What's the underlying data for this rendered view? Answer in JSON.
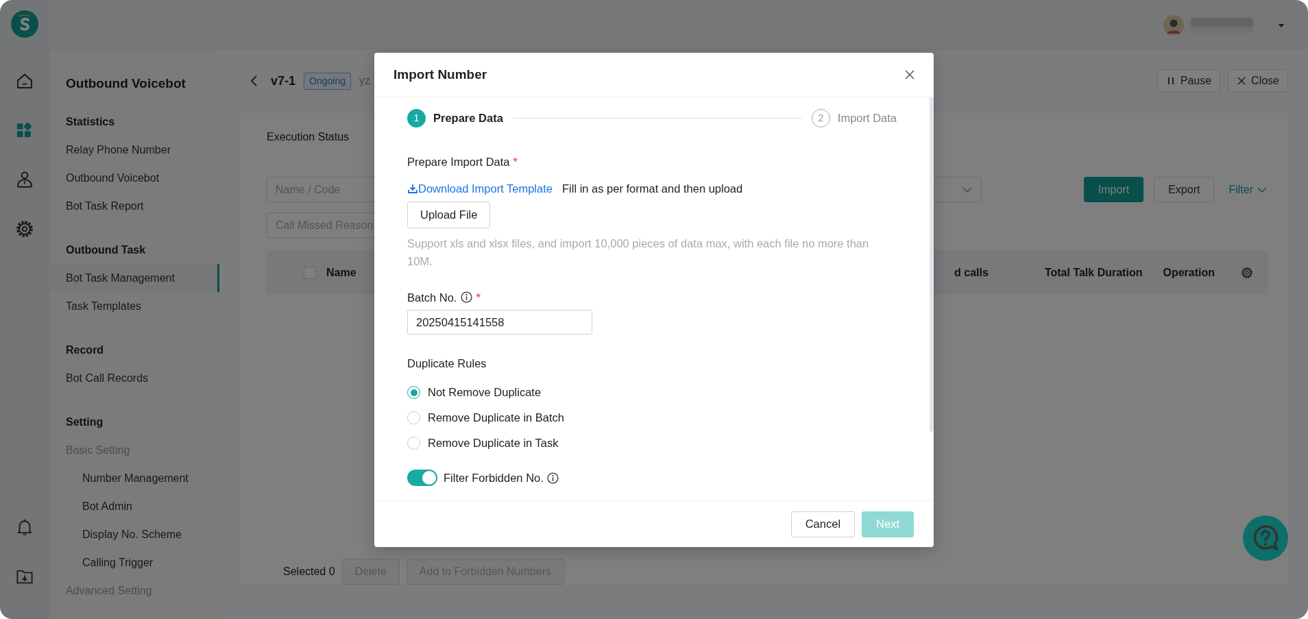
{
  "rail": {
    "top": [
      {
        "kind": "home",
        "selected": false
      },
      {
        "kind": "apps",
        "selected": true
      },
      {
        "kind": "user",
        "selected": false
      },
      {
        "kind": "settings",
        "selected": false
      }
    ],
    "bottom": [
      {
        "kind": "bell",
        "selected": false
      },
      {
        "kind": "download",
        "selected": false
      }
    ]
  },
  "sidebar": {
    "title": "Outbound Voicebot",
    "sections": [
      {
        "heading": "Statistics",
        "items": [
          {
            "label": "Relay Phone Number",
            "selected": false
          },
          {
            "label": "Outbound Voicebot",
            "selected": false
          },
          {
            "label": "Bot Task Report",
            "selected": false
          }
        ]
      },
      {
        "heading": "Outbound Task",
        "items": [
          {
            "label": "Bot Task Management",
            "selected": true
          },
          {
            "label": "Task Templates",
            "selected": false
          }
        ]
      },
      {
        "heading": "Record",
        "items": [
          {
            "label": "Bot Call Records",
            "selected": false
          }
        ]
      },
      {
        "heading": "Setting",
        "items": [
          {
            "kind": "group",
            "label": "Basic Setting",
            "selected": false,
            "children": [
              {
                "label": "Number Management",
                "selected": false
              },
              {
                "label": "Bot Admin",
                "selected": false
              },
              {
                "label": "Display No. Scheme",
                "selected": false
              },
              {
                "label": "Calling Trigger",
                "selected": false
              }
            ]
          },
          {
            "kind": "group",
            "label": "Advanced Setting",
            "selected": false
          }
        ]
      }
    ]
  },
  "header": {
    "title": "v7-1",
    "status": "Ongoing",
    "subtitle": "yz",
    "actions": [
      {
        "kind": "pause",
        "label": "Pause"
      },
      {
        "kind": "close",
        "label": "Close"
      }
    ]
  },
  "section_title": "Execution Status",
  "filters": [
    {
      "kind": "text",
      "placeholder": "Name / Code"
    },
    {
      "kind": "select"
    },
    {
      "kind": "text",
      "placeholder": "Call Missed Reason"
    }
  ],
  "toolbar": [
    {
      "kind": "primary",
      "label": "Import"
    },
    {
      "kind": "secondary",
      "label": "Export"
    },
    {
      "kind": "link",
      "label": "Filter"
    }
  ],
  "table": {
    "select_all_checked": false,
    "columns": [
      "Name",
      "d calls",
      "Total Talk Duration",
      "Operation"
    ]
  },
  "footer": {
    "selected": "Selected 0",
    "actions": [
      {
        "label": "Delete",
        "disabled": true
      },
      {
        "label": "Add to Forbidden Numbers",
        "disabled": true
      }
    ]
  },
  "modal": {
    "title": "Import Number",
    "steps": [
      {
        "number": "1",
        "label": "Prepare Data",
        "selected": true
      },
      {
        "number": "2",
        "label": "Import Data",
        "selected": false
      }
    ],
    "prepare": {
      "label": "Prepare Import Data",
      "required_mark": "*",
      "link": "Download Import Template",
      "note": "Fill in as per format and then upload",
      "upload_button": "Upload File",
      "help": "Support xls and xlsx files, and import 10,000 pieces of data max, with each file no more than 10M."
    },
    "batch": {
      "label": "Batch No.",
      "required_mark": "*",
      "value": "20250415141558"
    },
    "duplicate_rules": {
      "label": "Duplicate Rules",
      "options": [
        {
          "label": "Not Remove Duplicate",
          "selected": true
        },
        {
          "label": "Remove Duplicate in Batch",
          "selected": false
        },
        {
          "label": "Remove Duplicate in Task",
          "selected": false
        }
      ]
    },
    "filter_forbidden": {
      "label": "Filter Forbidden No.",
      "on": true
    },
    "buttons": [
      {
        "kind": "secondary",
        "label": "Cancel",
        "disabled": false
      },
      {
        "kind": "primary",
        "label": "Next",
        "disabled": true
      }
    ]
  }
}
